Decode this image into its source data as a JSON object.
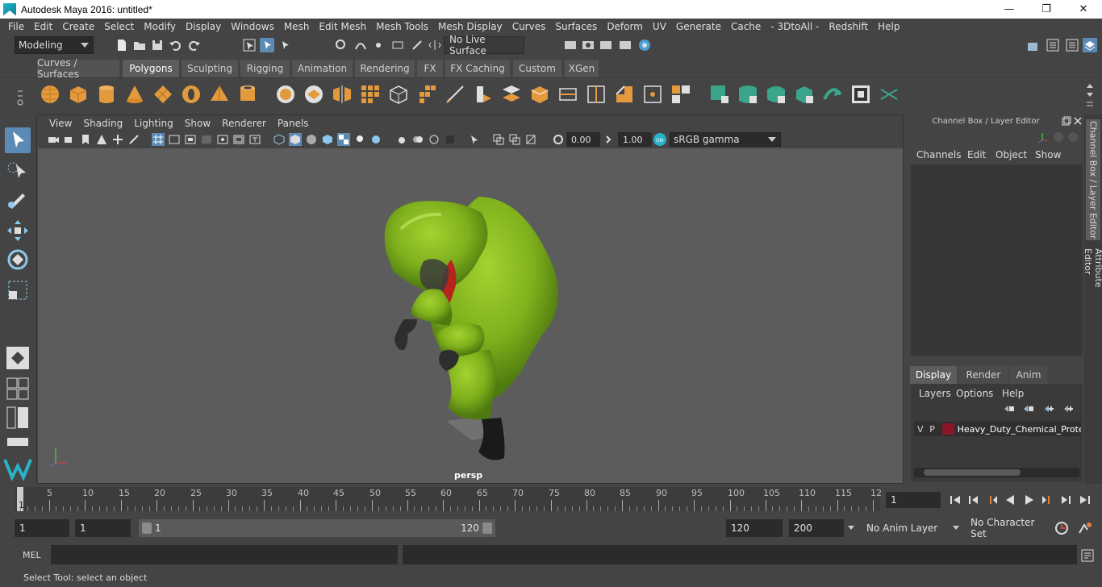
{
  "window": {
    "title": "Autodesk Maya 2016: untitled*",
    "controls": [
      "—",
      "❐",
      "✕"
    ]
  },
  "menubar": [
    "File",
    "Edit",
    "Create",
    "Select",
    "Modify",
    "Display",
    "Windows",
    "Mesh",
    "Edit Mesh",
    "Mesh Tools",
    "Mesh Display",
    "Curves",
    "Surfaces",
    "Deform",
    "UV",
    "Generate",
    "Cache",
    "- 3DtoAll -",
    "Redshift",
    "Help"
  ],
  "statusline": {
    "menuset": "Modeling",
    "live_surface": "No Live Surface"
  },
  "shelf": {
    "tabs": [
      "Curves / Surfaces",
      "Polygons",
      "Sculpting",
      "Rigging",
      "Animation",
      "Rendering",
      "FX",
      "FX Caching",
      "Custom",
      "XGen"
    ],
    "active_tab": "Polygons"
  },
  "viewport": {
    "menu": [
      "View",
      "Shading",
      "Lighting",
      "Show",
      "Renderer",
      "Panels"
    ],
    "exposure": "0.00",
    "gamma": "1.00",
    "color_space": "sRGB gamma",
    "camera_label": "persp"
  },
  "channel_box": {
    "title": "Channel Box / Layer Editor",
    "menu": [
      "Channels",
      "Edit",
      "Object",
      "Show"
    ]
  },
  "layer_editor": {
    "tabs": [
      "Display",
      "Render",
      "Anim"
    ],
    "active_tab": "Display",
    "menu": [
      "Layers",
      "Options",
      "Help"
    ],
    "layers": [
      {
        "v": "V",
        "p": "P",
        "color": "#8b1628",
        "name": "Heavy_Duty_Chemical_Protec"
      }
    ]
  },
  "side_tabs": [
    "Channel Box / Layer Editor",
    "Attribute Editor"
  ],
  "timeline": {
    "ticks": [
      "5",
      "10",
      "15",
      "20",
      "25",
      "30",
      "35",
      "40",
      "45",
      "50",
      "55",
      "60",
      "65",
      "70",
      "75",
      "80",
      "85",
      "90",
      "95",
      "100",
      "105",
      "110",
      "115",
      "12"
    ],
    "current_frame": "1",
    "current_frame_field": "1"
  },
  "range": {
    "start_field": "1",
    "playback_start": "1",
    "range_min": "1",
    "range_max": "120",
    "playback_end": "120",
    "end_field": "200",
    "anim_layer": "No Anim Layer",
    "character_set": "No Character Set"
  },
  "command_line": {
    "label": "MEL"
  },
  "help_line": "Select Tool: select an object"
}
